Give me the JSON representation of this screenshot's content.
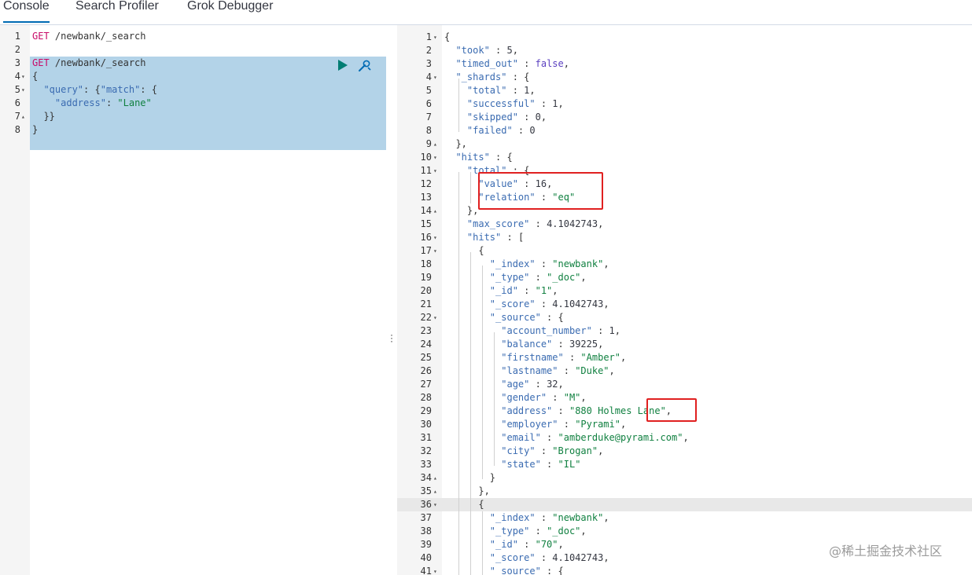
{
  "tabs": {
    "console": "Console",
    "search_profiler": "Search Profiler",
    "grok_debugger": "Grok Debugger"
  },
  "request": {
    "lines": [
      {
        "num": "1",
        "text": "GET /newbank/_search"
      },
      {
        "num": "2",
        "text": ""
      },
      {
        "num": "3",
        "text": "GET /newbank/_search"
      },
      {
        "num": "4",
        "text": "{"
      },
      {
        "num": "5",
        "text": "  \"query\": {\"match\": {"
      },
      {
        "num": "6",
        "text": "    \"address\": \"Lane\""
      },
      {
        "num": "7",
        "text": "  }}"
      },
      {
        "num": "8",
        "text": "}"
      }
    ]
  },
  "response": {
    "lines": [
      "{",
      "  \"took\" : 5,",
      "  \"timed_out\" : false,",
      "  \"_shards\" : {",
      "    \"total\" : 1,",
      "    \"successful\" : 1,",
      "    \"skipped\" : 0,",
      "    \"failed\" : 0",
      "  },",
      "  \"hits\" : {",
      "    \"total\" : {",
      "      \"value\" : 16,",
      "      \"relation\" : \"eq\"",
      "    },",
      "    \"max_score\" : 4.1042743,",
      "    \"hits\" : [",
      "      {",
      "        \"_index\" : \"newbank\",",
      "        \"_type\" : \"_doc\",",
      "        \"_id\" : \"1\",",
      "        \"_score\" : 4.1042743,",
      "        \"_source\" : {",
      "          \"account_number\" : 1,",
      "          \"balance\" : 39225,",
      "          \"firstname\" : \"Amber\",",
      "          \"lastname\" : \"Duke\",",
      "          \"age\" : 32,",
      "          \"gender\" : \"M\",",
      "          \"address\" : \"880 Holmes Lane\",",
      "          \"employer\" : \"Pyrami\",",
      "          \"email\" : \"amberduke@pyrami.com\",",
      "          \"city\" : \"Brogan\",",
      "          \"state\" : \"IL\"",
      "        }",
      "      },",
      "      {",
      "        \"_index\" : \"newbank\",",
      "        \"_type\" : \"_doc\",",
      "        \"_id\" : \"70\",",
      "        \"_score\" : 4.1042743,",
      "        \"_source\" : {"
    ]
  },
  "watermark": "@稀土掘金技术社区",
  "icons": {
    "run": "play-icon",
    "settings": "wrench-icon"
  },
  "colors": {
    "accent": "#006bb4",
    "selection": "#b3d3e8",
    "highlight_box": "#e02020",
    "run_button": "#017d73"
  }
}
